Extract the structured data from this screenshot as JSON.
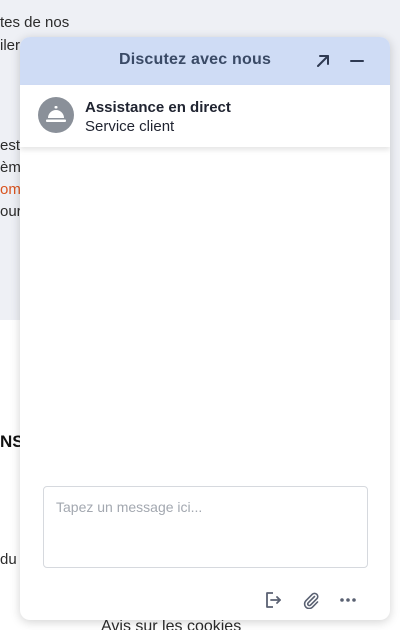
{
  "background": {
    "lines": [
      "tes de nos",
      "iler",
      "est",
      "èm",
      "om",
      "our",
      "du"
    ],
    "heading": "NS",
    "footer": "Avis sur les cookies"
  },
  "chat": {
    "title": "Discutez avec nous",
    "agent": {
      "name": "Assistance en direct",
      "subtitle": "Service client"
    },
    "composer": {
      "placeholder": "Tapez un message ici..."
    },
    "icons": {
      "expand": "arrow-up-right-icon",
      "minimize": "minimize-icon",
      "avatar": "service-bell-icon",
      "exit": "exit-chat-icon",
      "attach": "paperclip-icon",
      "more": "more-options-icon"
    }
  }
}
